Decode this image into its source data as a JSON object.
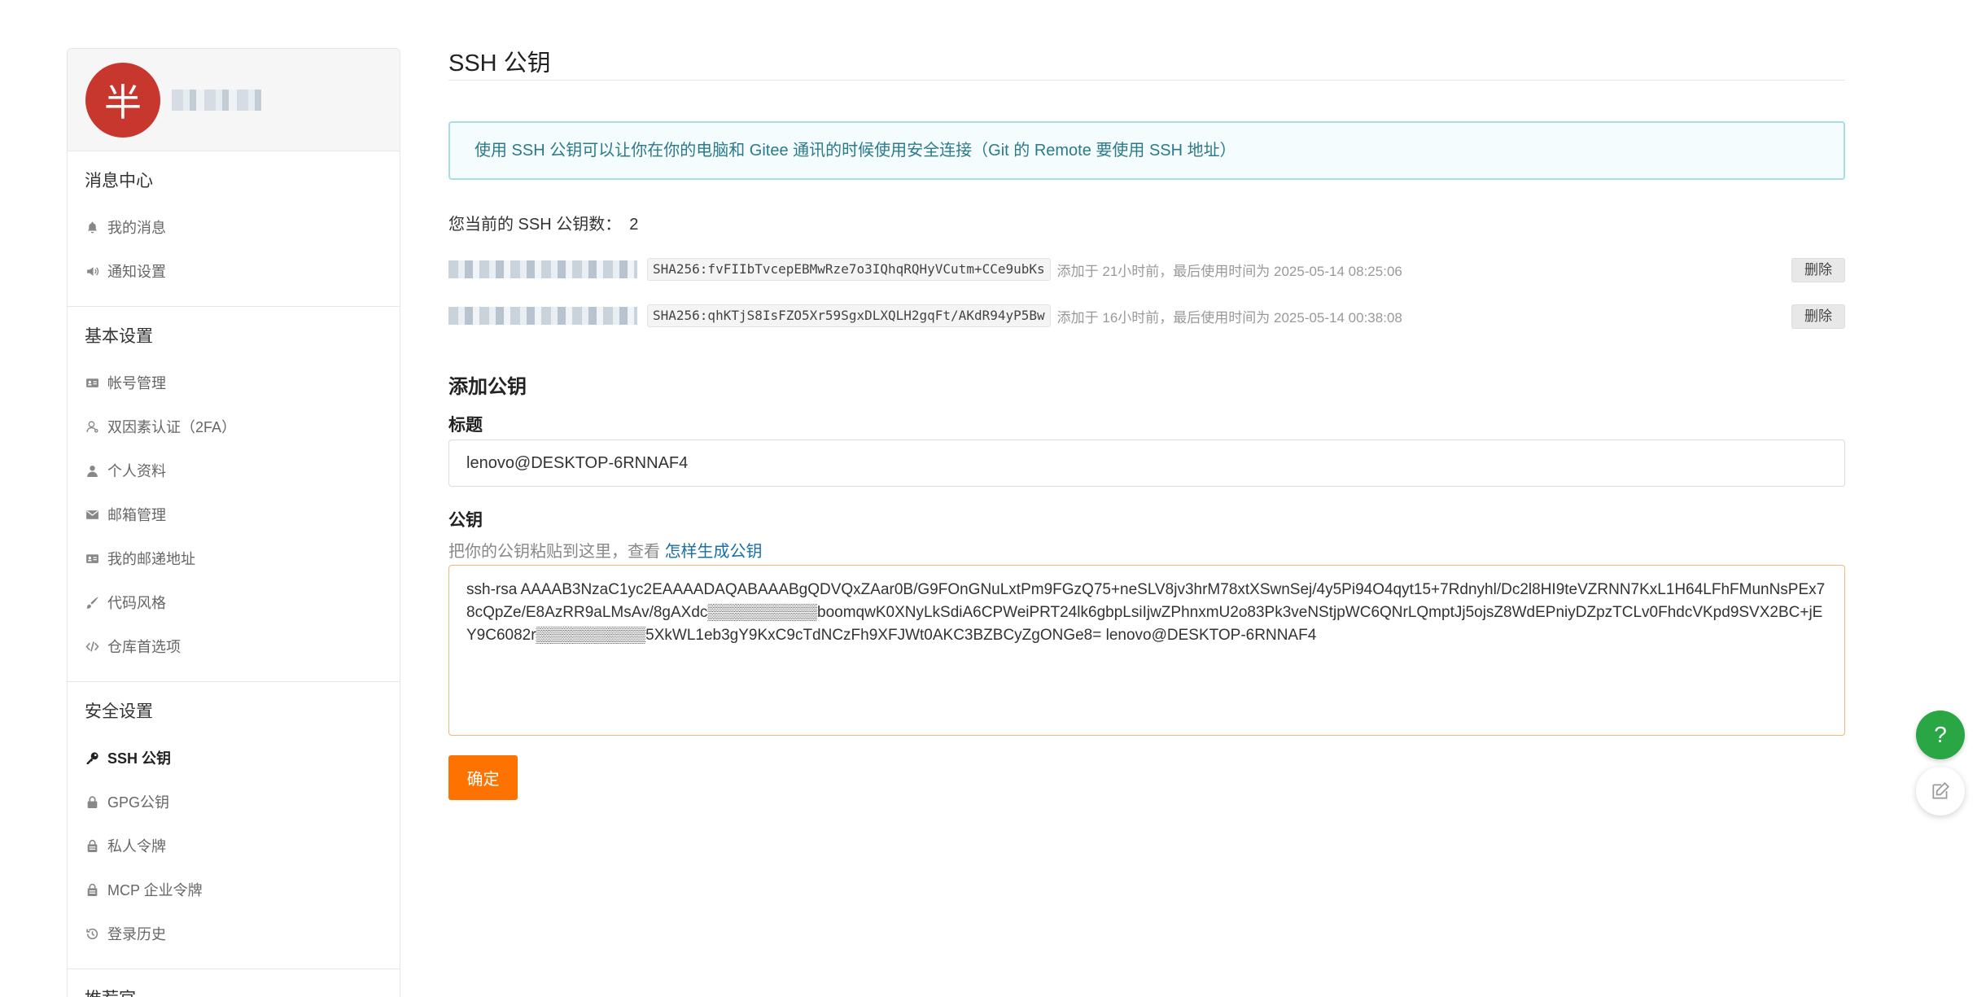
{
  "sidebar": {
    "avatar_char": "半",
    "groups": [
      {
        "title": "消息中心",
        "items": [
          {
            "label": "我的消息",
            "icon": "bell-icon"
          },
          {
            "label": "通知设置",
            "icon": "speaker-icon"
          }
        ]
      },
      {
        "title": "基本设置",
        "items": [
          {
            "label": "帐号管理",
            "icon": "id-card-icon"
          },
          {
            "label": "双因素认证（2FA）",
            "icon": "user-outline-icon"
          },
          {
            "label": "个人资料",
            "icon": "user-icon"
          },
          {
            "label": "邮箱管理",
            "icon": "envelope-icon"
          },
          {
            "label": "我的邮递地址",
            "icon": "id-card-icon"
          },
          {
            "label": "代码风格",
            "icon": "brush-icon"
          },
          {
            "label": "仓库首选项",
            "icon": "code-icon"
          }
        ]
      },
      {
        "title": "安全设置",
        "items": [
          {
            "label": "SSH 公钥",
            "icon": "key-icon",
            "active": true
          },
          {
            "label": "GPG公钥",
            "icon": "lock-icon"
          },
          {
            "label": "私人令牌",
            "icon": "token-icon"
          },
          {
            "label": "MCP 企业令牌",
            "icon": "token-icon"
          },
          {
            "label": "登录历史",
            "icon": "history-icon"
          }
        ]
      },
      {
        "title": "推荐官",
        "items": []
      }
    ]
  },
  "main": {
    "title": "SSH 公钥",
    "info": "使用 SSH 公钥可以让你在你的电脑和 Gitee 通讯的时候使用安全连接（Git 的 Remote 要使用 SSH 地址）",
    "count_label": "您当前的 SSH 公钥数：",
    "count_value": "2",
    "keys": [
      {
        "fingerprint": "SHA256:fvFIIbTvcepEBMwRze7o3IQhqRQHyVCutm+CCe9ubKs",
        "meta": "添加于 21小时前，最后使用时间为 2025-05-14 08:25:06",
        "delete_label": "删除"
      },
      {
        "fingerprint": "SHA256:qhKTjS8IsFZO5Xr59SgxDLXQLH2gqFt/AKdR94yP5Bw",
        "meta": "添加于 16小时前，最后使用时间为 2025-05-14 00:38:08",
        "delete_label": "删除"
      }
    ],
    "add_title": "添加公钥",
    "title_label": "标题",
    "title_value": "lenovo@DESKTOP-6RNNAF4",
    "key_label": "公钥",
    "hint_text": "把你的公钥粘贴到这里，查看 ",
    "hint_link": "怎样生成公钥",
    "key_value": "ssh-rsa AAAAB3NzaC1yc2EAAAADAQABAAABgQDVQxZAar0B/G9FOnGNuLxtPm9FGzQ75+neSLV8jv3hrM78xtXSwnSej/4y5Pi94O4qyt15+7Rdnyhl/Dc2l8HI9teVZRNN7KxL1H64LFhFMunNsPEx78cQpZe/E8AzRR9aLMsAv/8gAXdc▒▒▒▒▒▒▒▒▒▒boomqwK0XNyLkSdiA6CPWeiPRT24lk6gbpLsiIjwZPhnxmU2o83Pk3veNStjpWC6QNrLQmptJj5ojsZ8WdEPniyDZpzTCLv0FhdcVKpd9SVX2BC+jEY9C6082r▒▒▒▒▒▒▒▒▒▒5XkWL1eb3gY9KxC9cTdNCzFh9XFJWt0AKC3BZBCyZgONGe8= lenovo@DESKTOP-6RNNAF4",
    "confirm_label": "确定"
  },
  "floating": {
    "help_char": "?"
  },
  "colors": {
    "accent": "#fe7300",
    "avatar_bg": "#c8372d",
    "info_text": "#2b7a8c",
    "link": "#1a6fa8",
    "help_fab": "#2aa644"
  }
}
